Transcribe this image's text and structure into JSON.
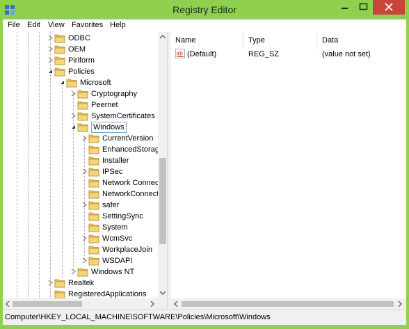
{
  "window": {
    "title": "Registry Editor",
    "colors": {
      "frame": "#8fd14f",
      "close": "#c7463b",
      "selection_border": "#7ea6d8",
      "folder": "#e8c15a"
    }
  },
  "menu": {
    "items": [
      {
        "label": "File"
      },
      {
        "label": "Edit"
      },
      {
        "label": "View"
      },
      {
        "label": "Favorites"
      },
      {
        "label": "Help"
      }
    ]
  },
  "tree": {
    "items": [
      {
        "label": "ODBC",
        "expander": "collapsed"
      },
      {
        "label": "OEM",
        "expander": "collapsed"
      },
      {
        "label": "Piriform",
        "expander": "collapsed"
      },
      {
        "label": "Policies",
        "expander": "expanded"
      },
      {
        "label": "Microsoft",
        "expander": "expanded"
      },
      {
        "label": "Cryptography",
        "expander": "collapsed"
      },
      {
        "label": "Peernet",
        "expander": "none"
      },
      {
        "label": "SystemCertificates",
        "expander": "collapsed"
      },
      {
        "label": "Windows",
        "expander": "expanded",
        "selected": true
      },
      {
        "label": "CurrentVersion",
        "expander": "collapsed"
      },
      {
        "label": "EnhancedStorageDevices",
        "expander": "none"
      },
      {
        "label": "Installer",
        "expander": "none"
      },
      {
        "label": "IPSec",
        "expander": "collapsed"
      },
      {
        "label": "Network Connections",
        "expander": "none"
      },
      {
        "label": "NetworkConnectivityStatusIndicator",
        "expander": "none"
      },
      {
        "label": "safer",
        "expander": "collapsed"
      },
      {
        "label": "SettingSync",
        "expander": "none"
      },
      {
        "label": "System",
        "expander": "none"
      },
      {
        "label": "WcmSvc",
        "expander": "collapsed"
      },
      {
        "label": "WorkplaceJoin",
        "expander": "none"
      },
      {
        "label": "WSDAPI",
        "expander": "collapsed"
      },
      {
        "label": "Windows NT",
        "expander": "collapsed"
      },
      {
        "label": "Realtek",
        "expander": "collapsed"
      },
      {
        "label": "RegisteredApplications",
        "expander": "none"
      }
    ]
  },
  "list": {
    "columns": [
      {
        "label": "Name"
      },
      {
        "label": "Type"
      },
      {
        "label": "Data"
      }
    ],
    "rows": [
      {
        "name": "(Default)",
        "type": "REG_SZ",
        "data": "(value not set)",
        "icon": "string-value-icon"
      }
    ]
  },
  "status": {
    "path": "Computer\\HKEY_LOCAL_MACHINE\\SOFTWARE\\Policies\\Microsoft\\Windows"
  }
}
